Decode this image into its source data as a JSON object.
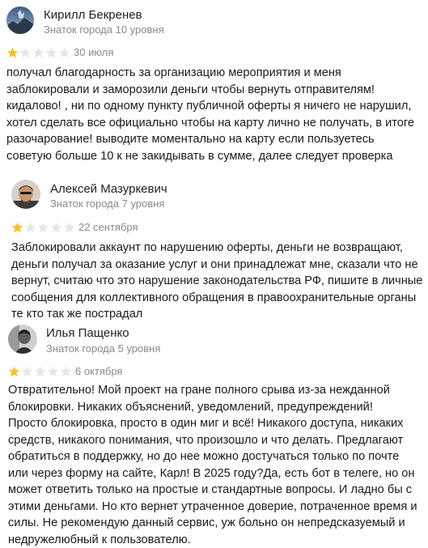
{
  "reviews": [
    {
      "author": "Кирилл Бекренев",
      "level": "Знаток города 10 уровня",
      "rating": 1,
      "max_rating": 5,
      "date": "30 июля",
      "text": "получал благодарность за организацию мероприятия и меня\nзаблокировали и заморозили деньги чтобы вернуть отправителям!\nкидалово! , ни по одному пункту публичной оферты я ничего не нарушил,\nхотел сделать все официально чтобы на карту лично не получать, в итоге\nразочарование! выводите моментально на карту если пользуетесь\nсоветую больше 10 к не закидывать в сумме, далее следует проверка",
      "avatar_icon": "landscape-avatar-icon"
    },
    {
      "author": "Алексей Мазуркевич",
      "level": "Знаток города 7 уровня",
      "rating": 1,
      "max_rating": 5,
      "date": "22 сентября",
      "text": "Заблокировали аккаунт по нарушению оферты, деньги не возвращают,\nденьги получал за оказание услуг и они принадлежат мне, сказали что не\nвернут, считаю что это нарушение законодательства РФ, пишите в личные\nсообщения для коллективного обращения в правоохранительные органы\nте кто так же пострадал",
      "avatar_icon": "person-photo-avatar-icon"
    },
    {
      "author": "Илья Пащенко",
      "level": "Знаток города 5 уровня",
      "rating": 1,
      "max_rating": 5,
      "date": "6 октября",
      "text": "Отвратительно! Мой проект на гране полного срыва из-за нежданной\nблокировки. Никаких объяснений, уведомлений, предупреждений!\nПросто блокировка, просто в один миг и всё! Никакого доступа, никаких\nсредств, никакого понимания, что произошло и что делать. Предлагают\nобратиться в поддержку, но до нее можно достучаться только по почте\nили через форму на сайте, Карл! В 2025 году?Да, есть бот в телеге, но он\nможет ответить только на простые и стандартные вопросы. И ладно бы с\nэтими деньгами. Но кто вернет утраченное доверие, потраченное время и\nсилы. Не рекомендую данный сервис, уж больно он непредсказуемый и\nнедружелюбный к пользователю.",
      "avatar_icon": "bw-photo-avatar-icon"
    }
  ],
  "colors": {
    "star_filled": "#fcbf1e",
    "star_empty": "#e6e6e6",
    "muted_text": "#8a8a8a",
    "main_text": "#1a1a1a"
  }
}
